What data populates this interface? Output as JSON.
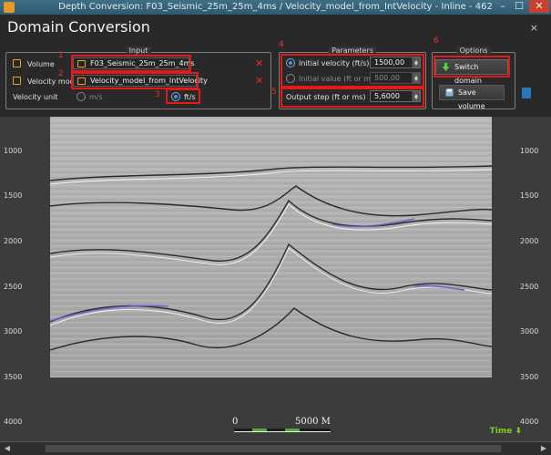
{
  "window": {
    "title": "Depth Conversion: F03_Seismic_25m_25m_4ms / Velocity_model_from_IntVelocity - Inline - 462",
    "min": "–",
    "max": "☐",
    "close": "✕"
  },
  "dialog": {
    "heading": "Domain Conversion",
    "close": "×"
  },
  "input": {
    "legend": "Input",
    "volume_label": "Volume",
    "volume_value": "F03_Seismic_25m_25m_4ms",
    "velocity_label": "Velocity mode",
    "velocity_value": "Velocity_model_from_IntVelocity",
    "unit_label": "Velocity unit",
    "unit_ms": "m/s",
    "unit_fts": "ft/s",
    "unit_selected": "ft/s",
    "remove": "✕"
  },
  "parameters": {
    "legend": "Parameters",
    "initial_velocity_label": "Initial velocity (ft/s)",
    "initial_velocity_value": "1500,00",
    "initial_value_label": "Initial value (ft or ms)",
    "initial_value_value": "500,00",
    "output_step_label": "Output step (ft or ms)",
    "output_step_value": "5,6000"
  },
  "options": {
    "legend": "Options",
    "switch_domain": "Switch domain",
    "save_volume": "Save volume"
  },
  "annotations": [
    "1",
    "2",
    "3",
    "4",
    "5",
    "6"
  ],
  "ruler": {
    "ticks": [
      "1000",
      "1500",
      "2000",
      "2500",
      "3000",
      "3500",
      "4000"
    ]
  },
  "scale": {
    "start": "0",
    "end": "5000 M"
  },
  "time_button": "Time",
  "colors": {
    "accent": "#e11b1b",
    "selected_radio": "#4f8fe0",
    "remove_icon": "#e12c2c",
    "time_button": "#7ed321"
  }
}
